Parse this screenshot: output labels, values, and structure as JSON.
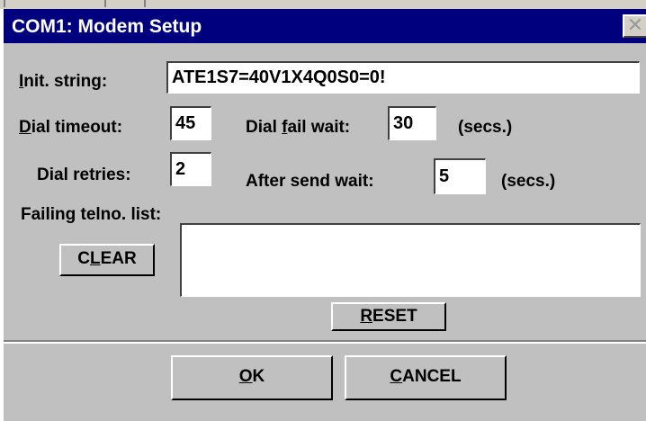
{
  "window": {
    "title": "COM1: Modem Setup",
    "close_glyph": "✕"
  },
  "fields": {
    "init_string": {
      "label_underline": "I",
      "label_rest": "nit. string:",
      "value": "ATE1S7=40V1X4Q0S0=0!"
    },
    "dial_timeout": {
      "label_underline": "D",
      "label_rest": "ial timeout:",
      "value": "45"
    },
    "dial_fail_wait": {
      "label_before": "Dial ",
      "label_underline": "f",
      "label_rest": "ail wait:",
      "value": "30",
      "unit": "(secs.)"
    },
    "dial_retries": {
      "label": "Dial retries:",
      "value": "2"
    },
    "after_send_wait": {
      "label": "After send wait:",
      "value": "5",
      "unit": "(secs.)"
    },
    "failing_telno_list": {
      "label": "Failing telno. list:",
      "value": ""
    }
  },
  "buttons": {
    "clear": {
      "before": "C",
      "underline": "L",
      "after": "EAR"
    },
    "reset": {
      "underline": "R",
      "after": "ESET"
    },
    "ok": {
      "underline": "O",
      "after": "K"
    },
    "cancel": {
      "underline": "C",
      "after": "ANCEL"
    }
  },
  "colors": {
    "titlebar": "#00007f",
    "face": "#c0c0c0",
    "field": "#ffffff"
  }
}
